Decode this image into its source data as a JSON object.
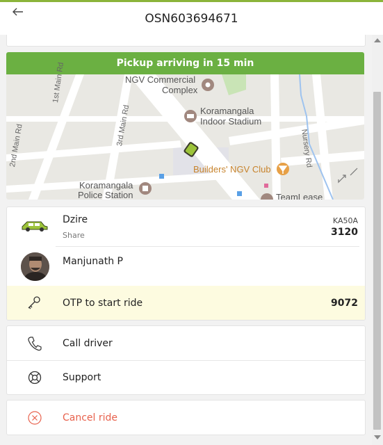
{
  "header": {
    "title": "OSN603694671"
  },
  "pickup": {
    "banner": "Pickup arriving in 15 min"
  },
  "map": {
    "labels": {
      "ngv_commercial_1": "NGV Commercial",
      "ngv_commercial_2": "Complex",
      "indoor_stadium_1": "Koramangala",
      "indoor_stadium_2": "Indoor Stadium",
      "builders_club": "Builders' NGV Club",
      "police_1": "Koramangala",
      "police_2": "Police Station",
      "teamlease": "TeamLease",
      "main_1st": "1st Main Rd",
      "main_2nd": "2nd Main Rd",
      "main_3rd": "3rd Main Rd",
      "nursery": "Nursery Rd"
    }
  },
  "ride": {
    "car_model": "Dzire",
    "car_type": "Share",
    "plate_line1": "KA50A",
    "plate_line2": "3120",
    "driver_name": "Manjunath P",
    "otp_label": "OTP to start ride",
    "otp_value": "9072"
  },
  "actions": {
    "call_driver": "Call driver",
    "support": "Support",
    "cancel_ride": "Cancel ride"
  },
  "colors": {
    "accent_green": "#6bb042",
    "cancel_red": "#e8614c",
    "otp_highlight": "#fdfbe0"
  }
}
